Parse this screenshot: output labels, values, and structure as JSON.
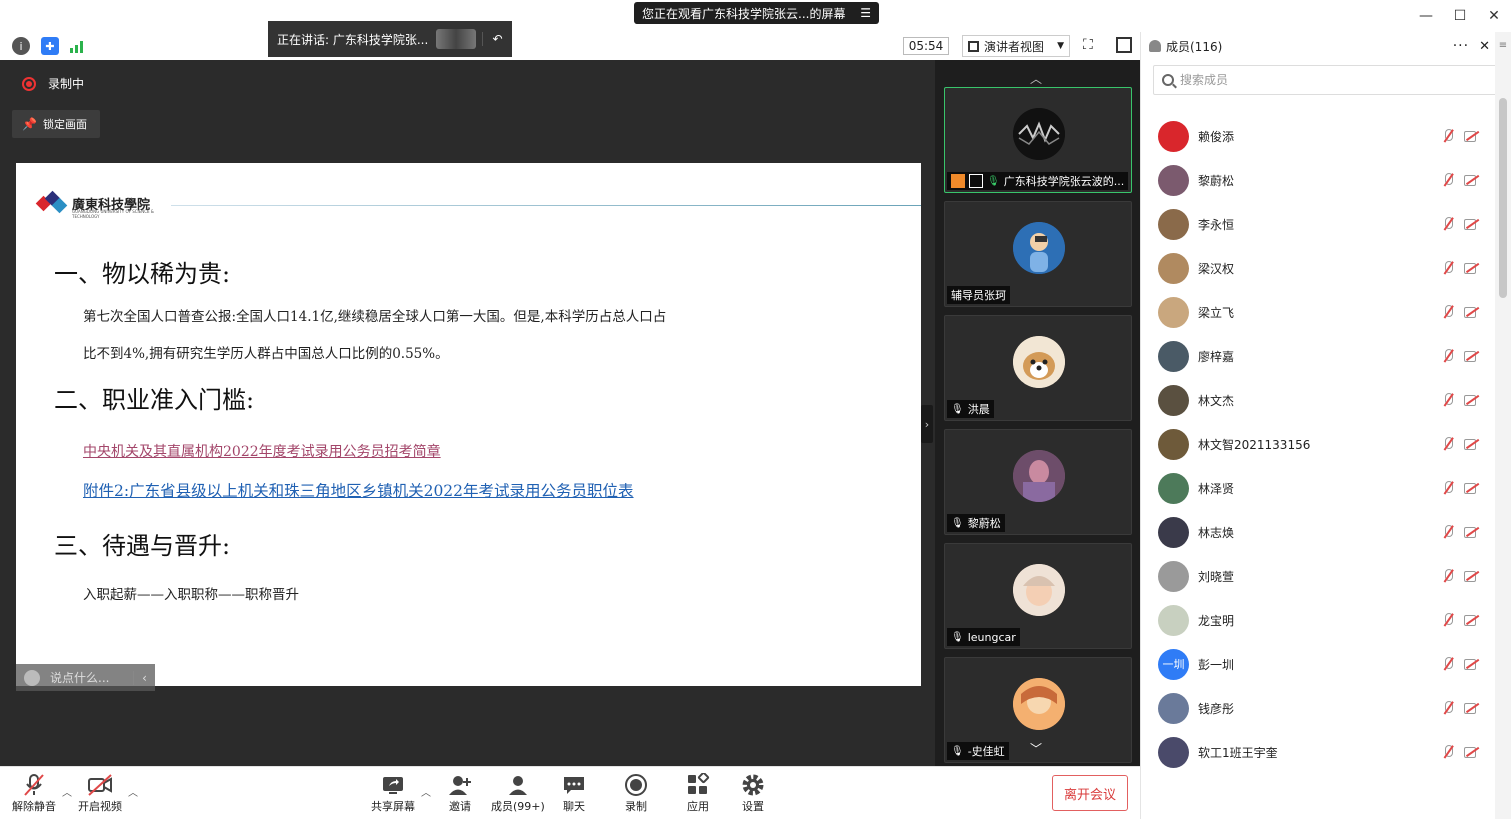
{
  "titlebar": {
    "watch_banner": "您正在观看广东科技学院张云...的屏幕",
    "menu_glyph": "☰"
  },
  "toolbar": {
    "speaking": "正在讲话: 广东科技学院张...",
    "timer": "05:54",
    "view_mode": "演讲者视图"
  },
  "stage": {
    "recording": "录制中",
    "lock_screen": "锁定画面",
    "chat_placeholder": "说点什么..."
  },
  "slide": {
    "logo_name": "廣東科技學院",
    "logo_sub": "GUANGDONG UNIVERSITY OF SCIENCE & TECHNOLOGY",
    "heading1": "一、物以稀为贵:",
    "para1_line1": "第七次全国人口普查公报:全国人口14.1亿,继续稳居全球人口第一大国。但是,本科学历占总人口占",
    "para1_line2": "比不到4%,拥有研究生学历人群占中国总人口比例的0.55%。",
    "heading2": "二、职业准入门槛:",
    "link1": "中央机关及其直属机构2022年度考试录用公务员招考简章",
    "link2": "附件2:广东省县级以上机关和珠三角地区乡镇机关2022年考试录用公务员职位表",
    "heading3": "三、待遇与晋升:",
    "para3": "入职起薪——入职职称——职称晋升"
  },
  "videos": [
    {
      "name": "广东科技学院张云波的...",
      "active": true
    },
    {
      "name": "辅导员张珂",
      "active": false
    },
    {
      "name": "洪晨",
      "active": false
    },
    {
      "name": "黎蔚松",
      "active": false
    },
    {
      "name": "leungcar",
      "active": false
    },
    {
      "name": "-史佳虹",
      "active": false
    }
  ],
  "panel": {
    "title": "成员(116)",
    "search_placeholder": "搜索成员",
    "members": [
      {
        "name": "赖俊添",
        "color": "#d9262c"
      },
      {
        "name": "黎蔚松",
        "color": "#7b5a6e"
      },
      {
        "name": "李永恒",
        "color": "#8a6a4a"
      },
      {
        "name": "梁汉权",
        "color": "#b08a60"
      },
      {
        "name": "梁立飞",
        "color": "#c9a77e"
      },
      {
        "name": "廖梓嘉",
        "color": "#4a5a66"
      },
      {
        "name": "林文杰",
        "color": "#5a5040"
      },
      {
        "name": "林文智2021133156",
        "color": "#6e5a3a"
      },
      {
        "name": "林泽贤",
        "color": "#4d7a5a"
      },
      {
        "name": "林志焕",
        "color": "#3a3a4a"
      },
      {
        "name": "刘晓萱",
        "color": "#9a9a9a"
      },
      {
        "name": "龙宝明",
        "color": "#c8d0c0"
      },
      {
        "name": "彭一圳",
        "color": "#2f7cf6",
        "initials": "一圳"
      },
      {
        "name": "钱彦彤",
        "color": "#6a7a9a"
      },
      {
        "name": "软工1班王宇奎",
        "color": "#4a4a6a"
      }
    ]
  },
  "bottombar": {
    "unmute": "解除静音",
    "start_video": "开启视频",
    "share_screen": "共享屏幕",
    "invite": "邀请",
    "members": "成员(99+)",
    "chat": "聊天",
    "record": "录制",
    "apps": "应用",
    "settings": "设置",
    "leave": "离开会议"
  }
}
